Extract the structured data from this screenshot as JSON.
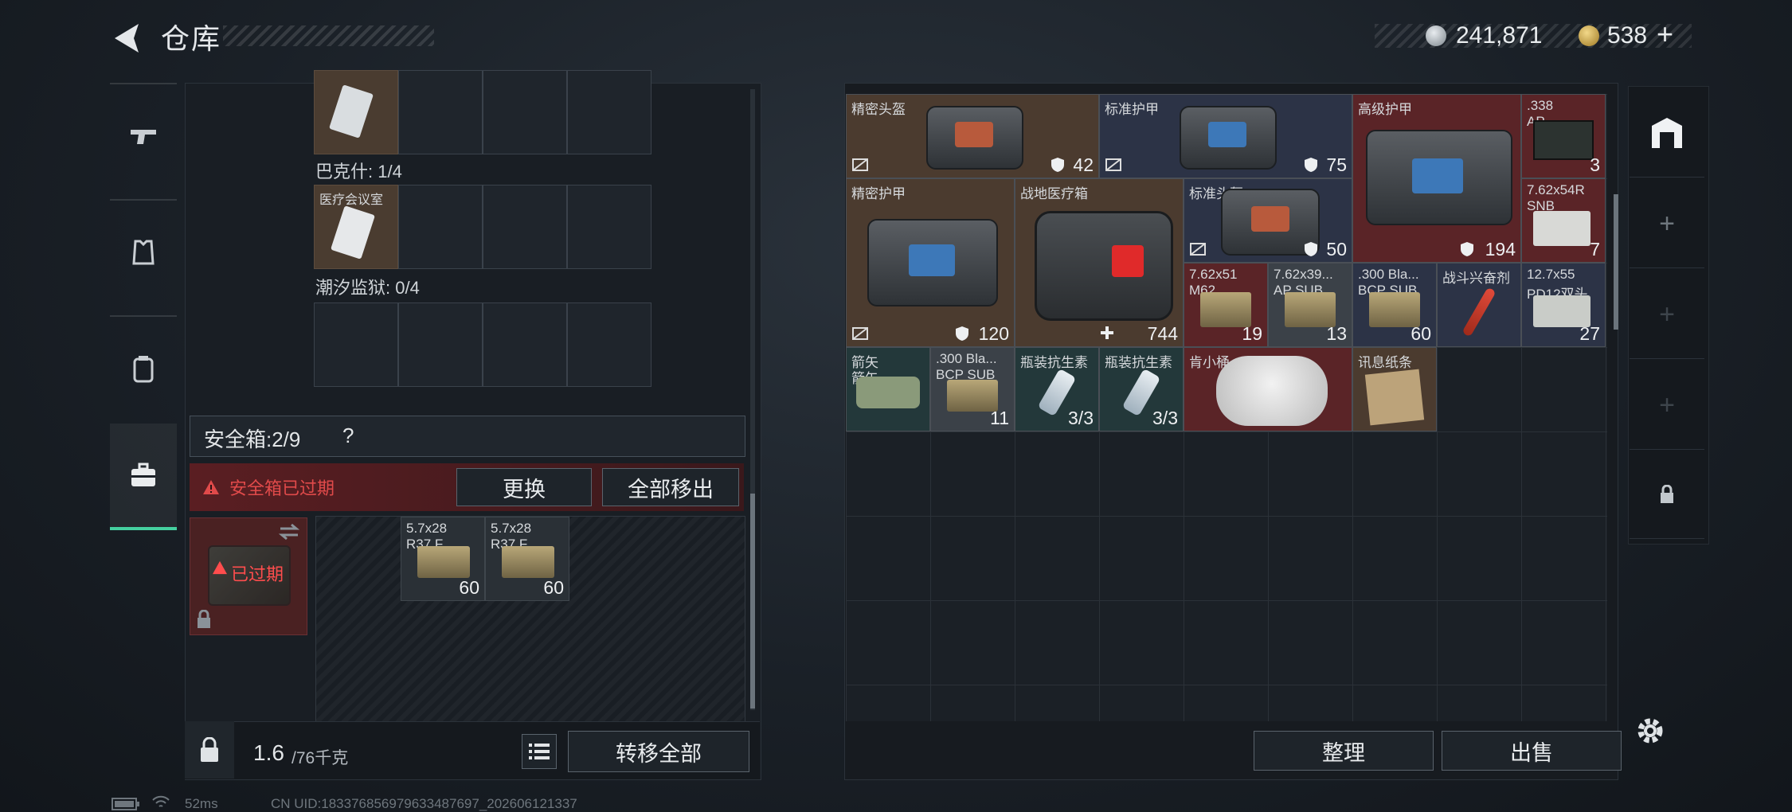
{
  "header": {
    "title": "仓库",
    "coins": "241,871",
    "bonds": "538",
    "bonds_plus": "+"
  },
  "containers": {
    "bakshi_label": "巴克什: 1/4",
    "medical_room_item": "医疗会议室",
    "tidal_prison_label": "潮汐监狱: 0/4"
  },
  "safebox": {
    "label": "安全箱:2/9",
    "help": "?",
    "expired_notice": "安全箱已过期",
    "replace_label": "更换",
    "move_all_label": "全部移出",
    "case_status": "已过期",
    "items": [
      {
        "name": "5.7x28",
        "name2": "R37.F",
        "count": "60"
      },
      {
        "name": "5.7x28",
        "name2": "R37.F",
        "count": "60"
      }
    ]
  },
  "bottom_left": {
    "weight": "1.6",
    "weight_unit": "/76千克",
    "transfer_all_label": "转移全部"
  },
  "stash": {
    "items": [
      {
        "name": "精密头盔",
        "value": "42"
      },
      {
        "name": "标准护甲",
        "value": "75"
      },
      {
        "name": "高级护甲",
        "value": "194"
      },
      {
        "name": ".338",
        "name2": "AP",
        "count": "3"
      },
      {
        "name": "精密护甲",
        "value": "120"
      },
      {
        "name": "战地医疗箱",
        "value": "744"
      },
      {
        "name": "标准头盔",
        "value": "50"
      },
      {
        "name": "7.62x54R",
        "name2": "SNB",
        "count": "7"
      },
      {
        "name": "7.62x51",
        "name2": "M62",
        "count": "19"
      },
      {
        "name": "7.62x39...",
        "name2": "AP SUB",
        "count": "13"
      },
      {
        "name": ".300 Bla...",
        "name2": "BCP SUB",
        "count": "60"
      },
      {
        "name": "战斗兴奋剂",
        "count": ""
      },
      {
        "name": "12.7x55",
        "name2": "PD12双头",
        "count": "27"
      },
      {
        "name": "箭矢",
        "name2": "箭矢",
        "count": ""
      },
      {
        "name": ".300 Bla...",
        "name2": "BCP SUB",
        "count": "11"
      },
      {
        "name": "瓶装抗生素",
        "count": "3/3"
      },
      {
        "name": "瓶装抗生素",
        "count": "3/3"
      },
      {
        "name": "肯小桶",
        "count": ""
      },
      {
        "name": "讯息纸条",
        "count": ""
      }
    ],
    "sort_label": "整理",
    "sell_label": "出售"
  },
  "status": {
    "ping": "52ms",
    "uid": "CN UID:1833768569796334876​97_202606121337"
  },
  "colors": {
    "accent": "#45d0a0",
    "danger": "#e04a4a"
  }
}
